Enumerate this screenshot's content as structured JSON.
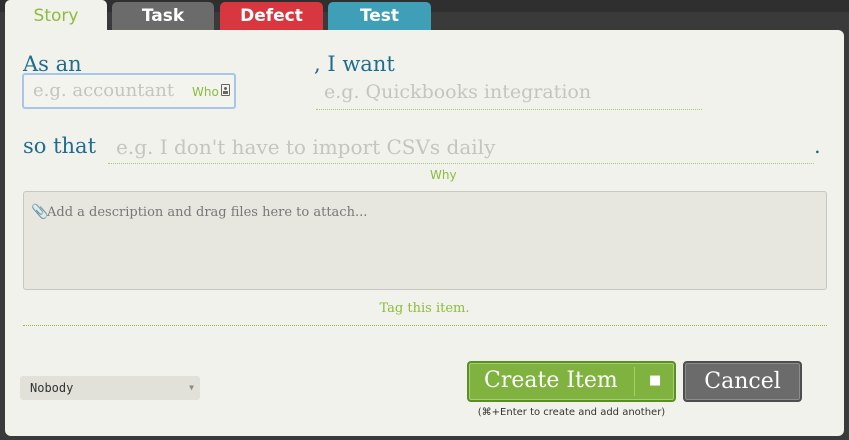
{
  "tabs": [
    {
      "label": "Story"
    },
    {
      "label": "Task"
    },
    {
      "label": "Defect"
    },
    {
      "label": "Test"
    }
  ],
  "form": {
    "as_an_label": "As an",
    "who_placeholder": "e.g. accountant",
    "who_hint": "Who",
    "i_want_label": ", I want",
    "want_placeholder": "e.g. Quickbooks integration",
    "so_that_label": "so that",
    "why_placeholder": "e.g. I don't have to import CSVs daily",
    "period": ".",
    "why_hint": "Why",
    "description_placeholder": "Add a description and drag files here to attach...",
    "tag_text": "Tag this item."
  },
  "owner_select": {
    "value": "Nobody"
  },
  "actions": {
    "create_label": "Create Item",
    "cancel_label": "Cancel",
    "shortcut_hint": "(⌘+Enter to create and add another)"
  },
  "colors": {
    "story_green": "#8dbb3f",
    "label_blue": "#1e6d8f",
    "defect_red": "#d9373f",
    "test_blue": "#3f9fb6",
    "task_gray": "#6b6b6b"
  }
}
